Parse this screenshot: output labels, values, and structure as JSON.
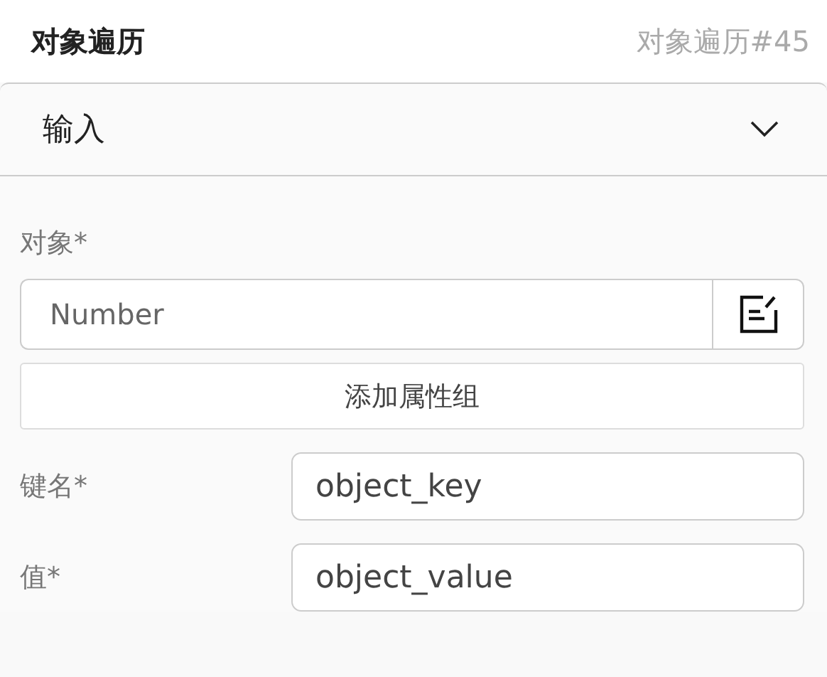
{
  "header": {
    "title": "对象遍历",
    "node_id": "对象遍历#45"
  },
  "section": {
    "title": "输入",
    "expanded": true
  },
  "object_field": {
    "label": "对象*",
    "value": "Number"
  },
  "add_button": "添加属性组",
  "rows": [
    {
      "label": "键名*",
      "value": "object_key"
    },
    {
      "label": "值*",
      "value": "object_value"
    }
  ]
}
